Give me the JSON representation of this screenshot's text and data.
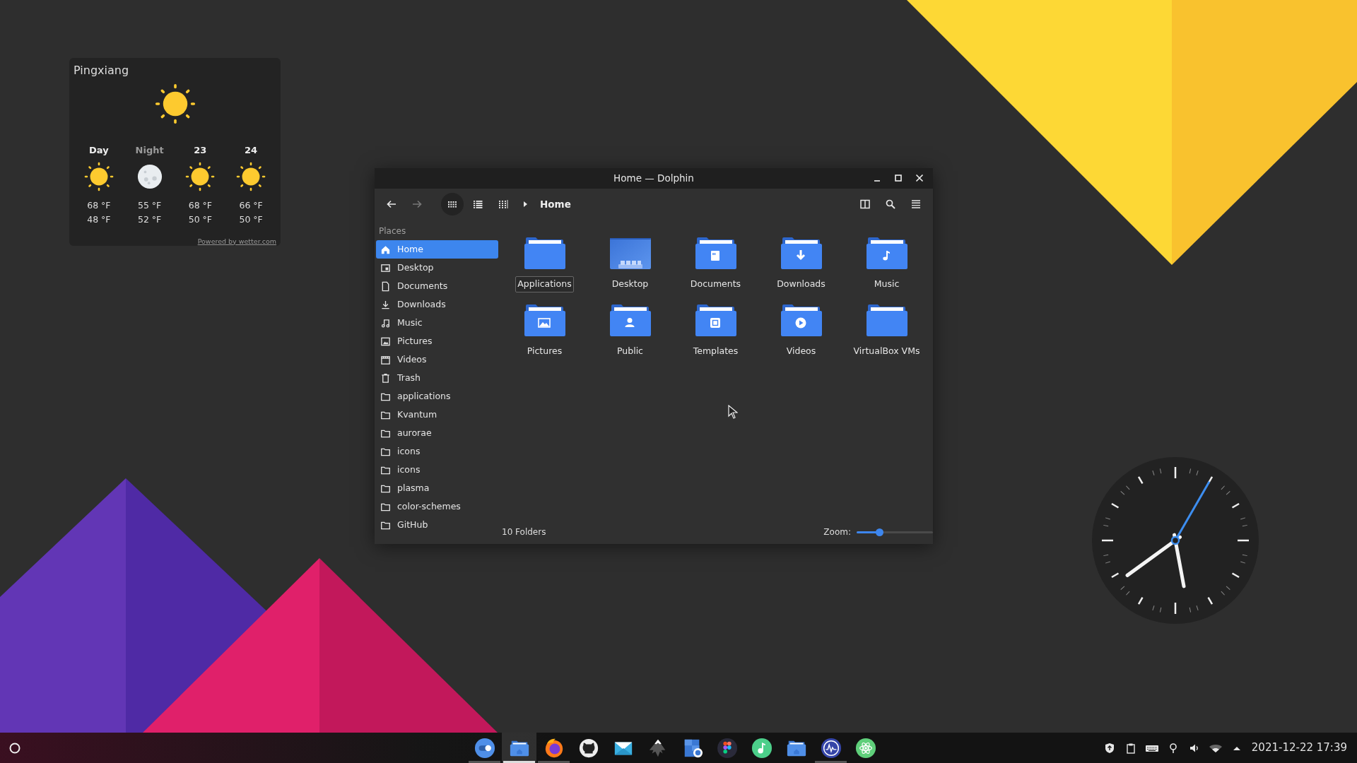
{
  "weather": {
    "city": "Pingxiang",
    "current": {
      "kind": "sun"
    },
    "forecast": [
      {
        "label": "Day",
        "muted": false,
        "kind": "sun",
        "high": "68 °F",
        "low": "48 °F"
      },
      {
        "label": "Night",
        "muted": true,
        "kind": "moon",
        "high": "55 °F",
        "low": "52 °F"
      },
      {
        "label": "23",
        "muted": false,
        "kind": "sun",
        "high": "68 °F",
        "low": "50 °F"
      },
      {
        "label": "24",
        "muted": false,
        "kind": "sun",
        "high": "66 °F",
        "low": "50 °F"
      }
    ],
    "credit": "Powered by wetter.com"
  },
  "window": {
    "title": "Home — Dolphin",
    "nav": [
      {
        "kind": "back",
        "disabled": false
      },
      {
        "kind": "forward",
        "disabled": true
      }
    ],
    "view_modes": [
      {
        "kind": "icons",
        "selected": true
      },
      {
        "kind": "details",
        "selected": false
      },
      {
        "kind": "compact",
        "selected": false
      }
    ],
    "breadcrumb": "Home",
    "places_heading": "Places",
    "places": [
      {
        "label": "Home",
        "kind": "home",
        "selected": true
      },
      {
        "label": "Desktop",
        "kind": "desktop",
        "selected": false
      },
      {
        "label": "Documents",
        "kind": "documents",
        "selected": false
      },
      {
        "label": "Downloads",
        "kind": "downloads",
        "selected": false
      },
      {
        "label": "Music",
        "kind": "music",
        "selected": false
      },
      {
        "label": "Pictures",
        "kind": "pictures",
        "selected": false
      },
      {
        "label": "Videos",
        "kind": "videos",
        "selected": false
      },
      {
        "label": "Trash",
        "kind": "trash",
        "selected": false
      },
      {
        "label": "applications",
        "kind": "folder",
        "selected": false
      },
      {
        "label": "Kvantum",
        "kind": "folder",
        "selected": false
      },
      {
        "label": "aurorae",
        "kind": "folder",
        "selected": false
      },
      {
        "label": "icons",
        "kind": "folder",
        "selected": false
      },
      {
        "label": "icons",
        "kind": "folder",
        "selected": false
      },
      {
        "label": "plasma",
        "kind": "folder",
        "selected": false
      },
      {
        "label": "color-schemes",
        "kind": "folder",
        "selected": false
      },
      {
        "label": "GitHub",
        "kind": "folder",
        "selected": false
      }
    ],
    "folders": [
      {
        "label": "Applications",
        "kind": "plain",
        "focused": true
      },
      {
        "label": "Desktop",
        "kind": "desktop",
        "focused": false
      },
      {
        "label": "Documents",
        "kind": "documents",
        "focused": false
      },
      {
        "label": "Downloads",
        "kind": "downloads",
        "focused": false
      },
      {
        "label": "Music",
        "kind": "music",
        "focused": false
      },
      {
        "label": "Pictures",
        "kind": "pictures",
        "focused": false
      },
      {
        "label": "Public",
        "kind": "public",
        "focused": false
      },
      {
        "label": "Templates",
        "kind": "templates",
        "focused": false
      },
      {
        "label": "Videos",
        "kind": "videos",
        "focused": false
      },
      {
        "label": "VirtualBox VMs",
        "kind": "plain",
        "focused": false
      }
    ],
    "status": "10 Folders",
    "zoom_label": "Zoom:",
    "zoom": {
      "level": 0.3
    }
  },
  "taskbar": {
    "apps": [
      {
        "kind": "toggle",
        "running": true,
        "selected": false
      },
      {
        "kind": "files",
        "running": true,
        "selected": true
      },
      {
        "kind": "globe",
        "running": true,
        "selected": false
      },
      {
        "kind": "cat",
        "running": false,
        "selected": false
      },
      {
        "kind": "mail",
        "running": false,
        "selected": false
      },
      {
        "kind": "mountain",
        "running": false,
        "selected": false
      },
      {
        "kind": "calendar",
        "running": false,
        "selected": false
      },
      {
        "kind": "dots",
        "running": false,
        "selected": false
      },
      {
        "kind": "note",
        "running": false,
        "selected": false
      },
      {
        "kind": "files",
        "running": false,
        "selected": false
      },
      {
        "kind": "wave",
        "running": true,
        "selected": false
      },
      {
        "kind": "atom",
        "running": false,
        "selected": false
      }
    ],
    "tray": [
      {
        "kind": "shield"
      },
      {
        "kind": "clipboard"
      },
      {
        "kind": "keyboard"
      },
      {
        "kind": "pin"
      },
      {
        "kind": "volume"
      },
      {
        "kind": "wifi"
      },
      {
        "kind": "caret"
      }
    ],
    "clock": "2021-12-22 17:39"
  }
}
